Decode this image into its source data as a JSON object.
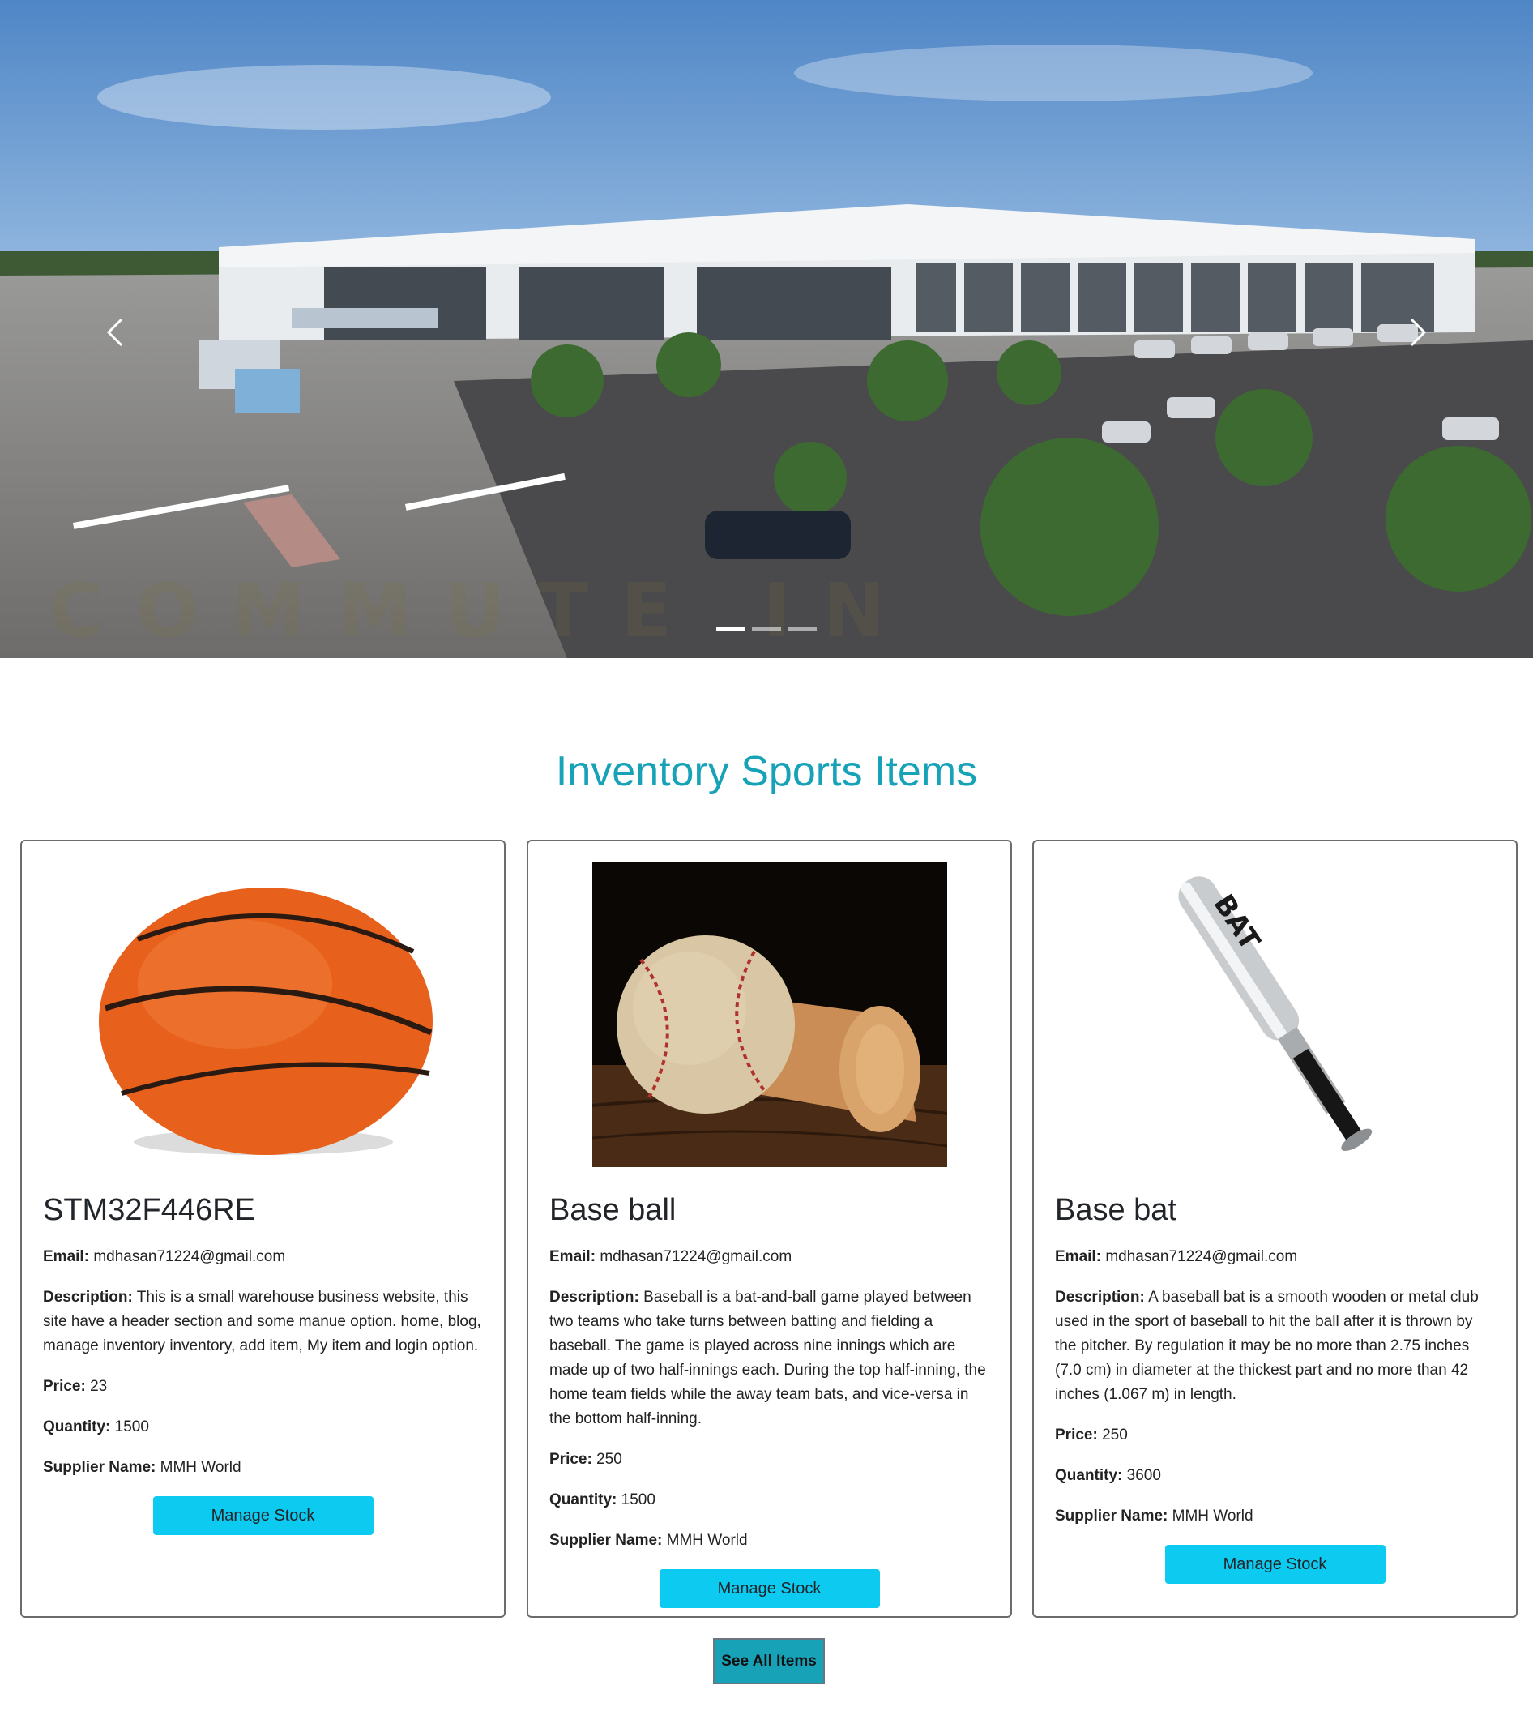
{
  "carousel": {
    "prev_icon": "chevron-left-icon",
    "next_icon": "chevron-right-icon",
    "watermark": "COMMUTE IN",
    "slides": 3,
    "active_slide": 1
  },
  "section": {
    "title": "Inventory Sports Items"
  },
  "labels": {
    "email": "Email:",
    "description": "Description:",
    "price": "Price:",
    "quantity": "Quantity:",
    "supplier": "Supplier Name:"
  },
  "items": [
    {
      "name": "STM32F446RE",
      "email": "mdhasan71224@gmail.com",
      "description": "This is a small warehouse business website, this site have a header section and some manue option. home, blog, manage inventory inventory, add item, My item and login option.",
      "price": "23",
      "quantity": "1500",
      "supplier": "MMH World",
      "button": "Manage Stock"
    },
    {
      "name": "Base ball",
      "email": "mdhasan71224@gmail.com",
      "description": "Baseball is a bat-and-ball game played between two teams who take turns between batting and fielding a baseball. The game is played across nine innings which are made up of two half-innings each. During the top half-inning, the home team fields while the away team bats, and vice-versa in the bottom half-inning.",
      "price": "250",
      "quantity": "1500",
      "supplier": "MMH World",
      "button": "Manage Stock"
    },
    {
      "name": "Base bat",
      "email": "mdhasan71224@gmail.com",
      "description": "A baseball bat is a smooth wooden or metal club used in the sport of baseball to hit the ball after it is thrown by the pitcher. By regulation it may be no more than 2.75 inches (7.0 cm) in diameter at the thickest part and no more than 42 inches (1.067 m) in length.",
      "price": "250",
      "quantity": "3600",
      "supplier": "MMH World",
      "button": "Manage Stock"
    }
  ],
  "footer_button": "See All Items",
  "colors": {
    "accent": "#17a2b8",
    "button": "#0dcaf0"
  }
}
